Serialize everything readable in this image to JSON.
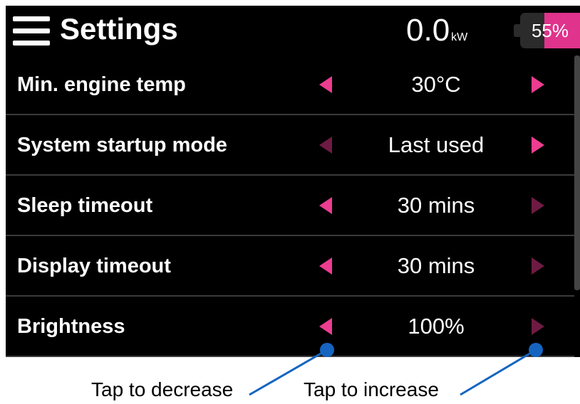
{
  "header": {
    "title": "Settings",
    "power_value": "0.0",
    "power_unit": "kW",
    "battery": {
      "text": "55%",
      "level_percent": 55
    }
  },
  "settings": [
    {
      "label": "Min. engine temp",
      "value": "30°C",
      "decrease_enabled": true,
      "increase_enabled": true
    },
    {
      "label": "System startup mode",
      "value": "Last used",
      "decrease_enabled": false,
      "increase_enabled": true
    },
    {
      "label": "Sleep timeout",
      "value": "30 mins",
      "decrease_enabled": true,
      "increase_enabled": false
    },
    {
      "label": "Display timeout",
      "value": "30 mins",
      "decrease_enabled": true,
      "increase_enabled": false
    },
    {
      "label": "Brightness",
      "value": "100%",
      "decrease_enabled": true,
      "increase_enabled": false
    }
  ],
  "annotations": {
    "decrease_label": "Tap to decrease",
    "increase_label": "Tap to increase"
  },
  "colors": {
    "accent": "#ec3d90",
    "accent_dim": "#6e1b43",
    "callout": "#1565c0",
    "background": "#000000"
  }
}
